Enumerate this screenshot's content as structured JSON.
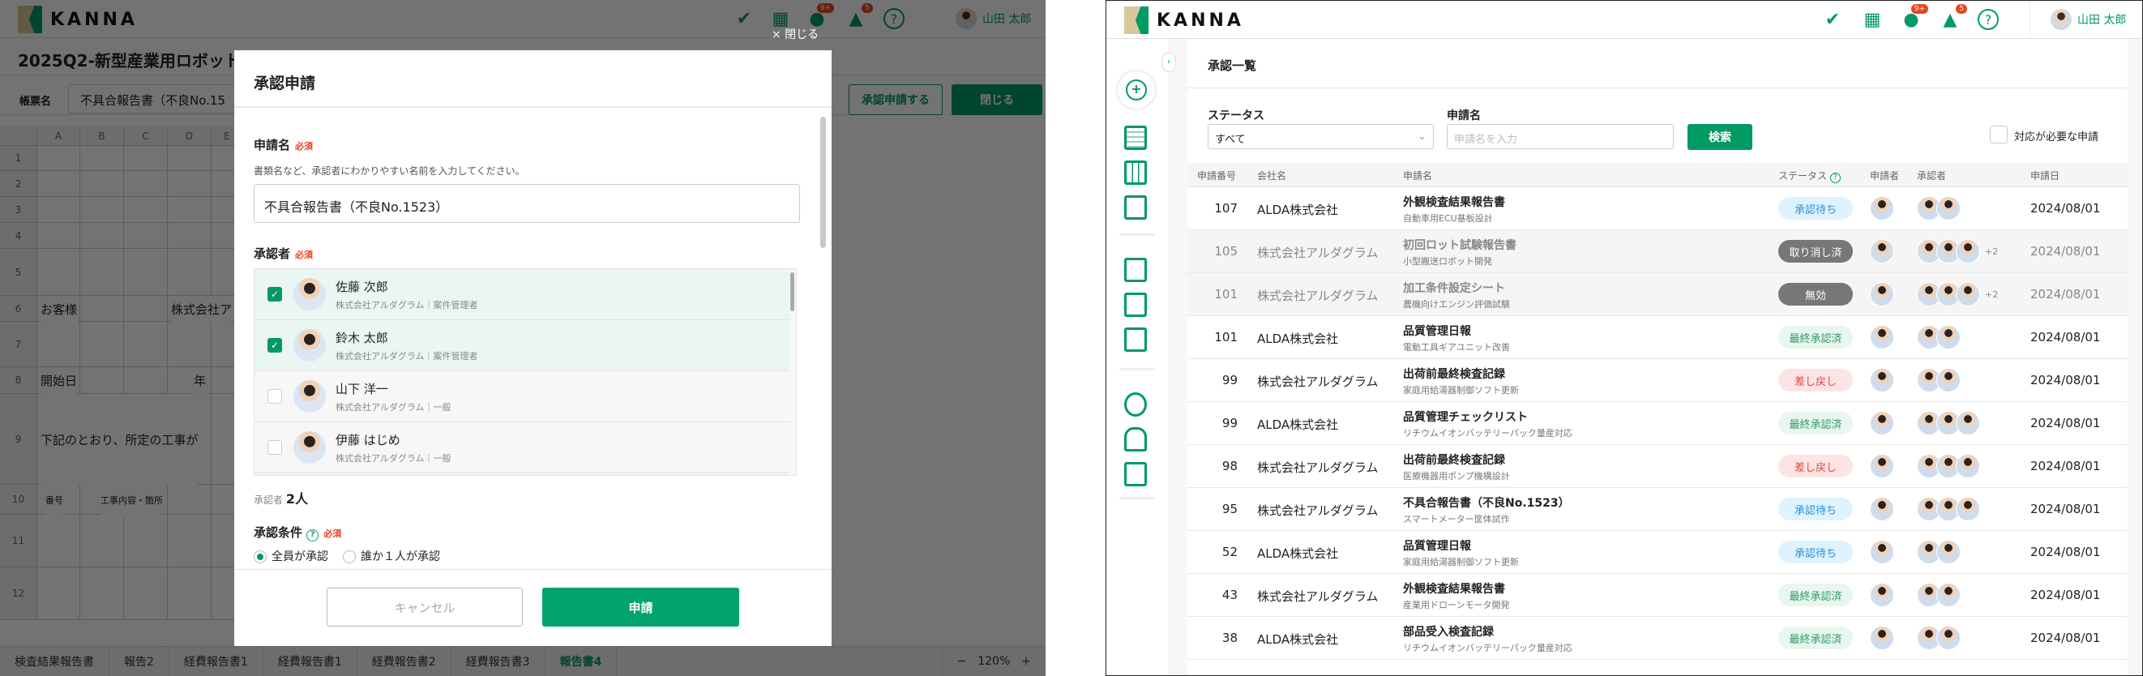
{
  "left": {
    "brand": "KANNA",
    "header": {
      "chat_badge": "9+",
      "bell_badge": "5",
      "user_name": "山田 太郎"
    },
    "close_overlay": "× 閉じる",
    "doc_title": "2025Q2-新型産業用ロボット",
    "form_label": "帳票名",
    "form_value": "不具合報告書（不良No.15",
    "request_button": "承認申請する",
    "close_button": "閉じる",
    "columns": [
      "A",
      "B",
      "C",
      "D",
      "E"
    ],
    "rows": [
      "1",
      "2",
      "3",
      "4",
      "5",
      "6",
      "7",
      "8",
      "9",
      "10",
      "11",
      "12"
    ],
    "cells": {
      "customer": "お客様",
      "company": "株式会社ア",
      "start": "開始日",
      "year": "年",
      "notice": "下記のとおり、所定の工事が",
      "no": "番号",
      "work": "工事内容・箇所"
    },
    "tabs": [
      "検査結果報告書",
      "報告2",
      "経費報告書1",
      "経費報告書1",
      "経費報告書2",
      "経費報告書3",
      "報告書4"
    ],
    "zoom": "120%",
    "zoom_minus": "−",
    "zoom_plus": "+",
    "modal": {
      "title": "承認申請",
      "name_label": "申請名",
      "required": "必須",
      "name_help": "書類名など、承認者にわかりやすい名前を入力してください。",
      "name_value": "不具合報告書（不良No.1523）",
      "approver_label": "承認者",
      "approvers": [
        {
          "name": "佐藤 次郎",
          "sub": "株式会社アルダグラム｜案件管理者",
          "checked": true
        },
        {
          "name": "鈴木 太郎",
          "sub": "株式会社アルダグラム｜案件管理者",
          "checked": true
        },
        {
          "name": "山下 洋一",
          "sub": "株式会社アルダグラム｜一般",
          "checked": false
        },
        {
          "name": "伊藤 はじめ",
          "sub": "株式会社アルダグラム｜一般",
          "checked": false
        }
      ],
      "count_label": "承認者",
      "count_value": "2人",
      "condition_label": "承認条件",
      "condition_options": [
        "全員が承認",
        "誰か１人が承認"
      ],
      "condition_selected": 0,
      "cancel": "キャンセル",
      "submit": "申請"
    }
  },
  "right": {
    "brand": "KANNA",
    "header": {
      "chat_badge": "9+",
      "bell_badge": "5",
      "user_name": "山田 太郎"
    },
    "page_title": "承認一覧",
    "filters": {
      "status_label": "ステータス",
      "status_value": "すべて",
      "name_label": "申請名",
      "name_placeholder": "申請名を入力",
      "search": "検索",
      "needs_action": "対応が必要な申請"
    },
    "columns": [
      "申請番号",
      "会社名",
      "申請名",
      "ステータス",
      "申請者",
      "承認者",
      "申請日"
    ],
    "status_colors": {
      "承認待ち": [
        "#def3fd",
        "#2a8fd6"
      ],
      "取り消し済": [
        "#777777",
        "#ffffff"
      ],
      "無効": [
        "#777777",
        "#ffffff"
      ],
      "最終承認済": [
        "#e8f6ef",
        "#2f9a68"
      ],
      "差し戻し": [
        "#fde4e4",
        "#e0483e"
      ]
    },
    "rows": [
      {
        "no": "107",
        "company": "ALDA株式会社",
        "title": "外観検査結果報告書",
        "project": "自動車用ECU基板設計",
        "status": "承認待ち",
        "approvers": 2,
        "extra": "",
        "date": "2024/08/01",
        "dim": false
      },
      {
        "no": "105",
        "company": "株式会社アルダグラム",
        "title": "初回ロット試験報告書",
        "project": "小型搬送ロボット開発",
        "status": "取り消し済",
        "approvers": 3,
        "extra": "+2",
        "date": "2024/08/01",
        "dim": true
      },
      {
        "no": "101",
        "company": "株式会社アルダグラム",
        "title": "加工条件設定シート",
        "project": "農機向けエンジン評価試験",
        "status": "無効",
        "approvers": 3,
        "extra": "+2",
        "date": "2024/08/01",
        "dim": true
      },
      {
        "no": "101",
        "company": "ALDA株式会社",
        "title": "品質管理日報",
        "project": "電動工具ギアユニット改善",
        "status": "最終承認済",
        "approvers": 2,
        "extra": "",
        "date": "2024/08/01",
        "dim": false
      },
      {
        "no": "99",
        "company": "株式会社アルダグラム",
        "title": "出荷前最終検査記録",
        "project": "家庭用給湯器制御ソフト更新",
        "status": "差し戻し",
        "approvers": 2,
        "extra": "",
        "date": "2024/08/01",
        "dim": false
      },
      {
        "no": "99",
        "company": "ALDA株式会社",
        "title": "品質管理チェックリスト",
        "project": "リチウムイオンバッテリーパック量産対応",
        "status": "最終承認済",
        "approvers": 3,
        "extra": "",
        "date": "2024/08/01",
        "dim": false
      },
      {
        "no": "98",
        "company": "株式会社アルダグラム",
        "title": "出荷前最終検査記録",
        "project": "医療機器用ポンプ機構設計",
        "status": "差し戻し",
        "approvers": 3,
        "extra": "",
        "date": "2024/08/01",
        "dim": false
      },
      {
        "no": "95",
        "company": "株式会社アルダグラム",
        "title": "不具合報告書（不良No.1523）",
        "project": "スマートメーター筐体試作",
        "status": "承認待ち",
        "approvers": 3,
        "extra": "",
        "date": "2024/08/01",
        "dim": false
      },
      {
        "no": "52",
        "company": "ALDA株式会社",
        "title": "品質管理日報",
        "project": "家庭用給湯器制御ソフト更新",
        "status": "承認待ち",
        "approvers": 2,
        "extra": "",
        "date": "2024/08/01",
        "dim": false
      },
      {
        "no": "43",
        "company": "株式会社アルダグラム",
        "title": "外観検査結果報告書",
        "project": "産業用ドローンモータ開発",
        "status": "最終承認済",
        "approvers": 2,
        "extra": "",
        "date": "2024/08/01",
        "dim": false
      },
      {
        "no": "38",
        "company": "ALDA株式会社",
        "title": "部品受入検査記録",
        "project": "リチウムイオンバッテリーパック量産対応",
        "status": "最終承認済",
        "approvers": 2,
        "extra": "",
        "date": "2024/08/01",
        "dim": false
      }
    ]
  }
}
